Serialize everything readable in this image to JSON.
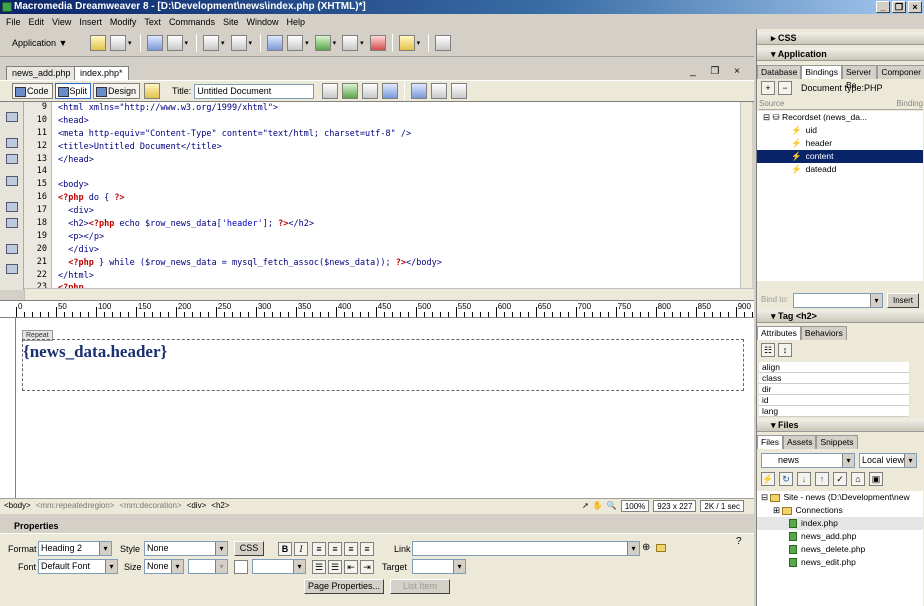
{
  "window": {
    "title": "Macromedia Dreamweaver 8 - [D:\\Development\\news\\index.php (XHTML)*]"
  },
  "menu": [
    "File",
    "Edit",
    "View",
    "Insert",
    "Modify",
    "Text",
    "Commands",
    "Site",
    "Window",
    "Help"
  ],
  "insert_bar": {
    "category": "Application"
  },
  "doc_tabs": [
    {
      "label": "news_add.php"
    },
    {
      "label": "index.php*"
    }
  ],
  "doc_toolbar": {
    "code_label": "Code",
    "split_label": "Split",
    "design_label": "Design",
    "title_label": "Title:",
    "title_value": "Untitled Document"
  },
  "code_lines": [
    {
      "n": "9",
      "text": "<html xmlns=\"http://www.w3.org/1999/xhtml\">"
    },
    {
      "n": "10",
      "text": "<head>"
    },
    {
      "n": "11",
      "text": "<meta http-equiv=\"Content-Type\" content=\"text/html; charset=utf-8\" />"
    },
    {
      "n": "12",
      "text": "<title>Untitled Document</title>"
    },
    {
      "n": "13",
      "text": "</head>"
    },
    {
      "n": "14",
      "text": ""
    },
    {
      "n": "15",
      "text": "<body>"
    },
    {
      "n": "16",
      "text": "<?php do { ?>"
    },
    {
      "n": "17",
      "text": "  <div>"
    },
    {
      "n": "18",
      "text": "  <h2><?php echo $row_news_data['header']; ?></h2>"
    },
    {
      "n": "19",
      "text": "  <p></p>"
    },
    {
      "n": "20",
      "text": "  </div>"
    },
    {
      "n": "21",
      "text": "  <?php } while ($row_news_data = mysql_fetch_assoc($news_data)); ?></body>"
    },
    {
      "n": "22",
      "text": "</html>"
    },
    {
      "n": "23",
      "text": "<?php"
    }
  ],
  "ruler_labels": [
    "0",
    "50",
    "100",
    "150",
    "200",
    "250",
    "300",
    "350",
    "400",
    "450",
    "500",
    "550",
    "600",
    "650",
    "700",
    "750",
    "800",
    "850",
    "900"
  ],
  "design": {
    "repeat_label": "Repeat",
    "header_text": "{news_data.header}"
  },
  "status": {
    "tags": [
      {
        "t": "<body>",
        "dim": false
      },
      {
        "t": "<mm:repeatedregion>",
        "dim": true
      },
      {
        "t": "<mm:decoration>",
        "dim": true
      },
      {
        "t": "<div>",
        "dim": false
      },
      {
        "t": "<h2>",
        "dim": false
      }
    ],
    "zoom": "100%",
    "size": "923 x 227",
    "dl": "2K / 1 sec"
  },
  "properties": {
    "header": "Properties",
    "format_label": "Format",
    "format_value": "Heading 2",
    "style_label": "Style",
    "style_value": "None",
    "css_btn": "CSS",
    "bold": "B",
    "italic": "I",
    "link_label": "Link",
    "link_value": "",
    "font_label": "Font",
    "font_value": "Default Font",
    "size_label": "Size",
    "size_value": "None",
    "target_label": "Target",
    "target_value": "",
    "page_props_btn": "Page Properties...",
    "list_item_btn": "List Item"
  },
  "panels": {
    "css_header": "CSS",
    "application_header": "Application",
    "app_tabs": [
      "Database",
      "Bindings",
      "Server Be",
      "Componer"
    ],
    "doc_type": "Document type:PHP",
    "col_source": "Source",
    "col_binding": "Binding",
    "recordset": "Recordset (news_da...",
    "fields": [
      {
        "name": "uid"
      },
      {
        "name": "header"
      },
      {
        "name": "content"
      },
      {
        "name": "dateadd"
      }
    ],
    "bind_to_label": "Bind to:",
    "insert_btn": "Insert",
    "tag_header": "Tag <h2>",
    "tag_tabs": [
      "Attributes",
      "Behaviors"
    ],
    "attributes": [
      "align",
      "class",
      "dir",
      "id",
      "lang"
    ],
    "files_header": "Files",
    "files_tabs": [
      "Files",
      "Assets",
      "Snippets"
    ],
    "site_value": "news",
    "view_value": "Local view",
    "site_root": "Site - news (D:\\Development\\new",
    "connections": "Connections",
    "files": [
      {
        "name": "index.php"
      },
      {
        "name": "news_add.php"
      },
      {
        "name": "news_delete.php"
      },
      {
        "name": "news_edit.php"
      }
    ]
  },
  "colors": {
    "title_bar": "#0a246a",
    "selection": "#0a246a",
    "php_tag": "#c00000",
    "code_text": "#000080"
  }
}
